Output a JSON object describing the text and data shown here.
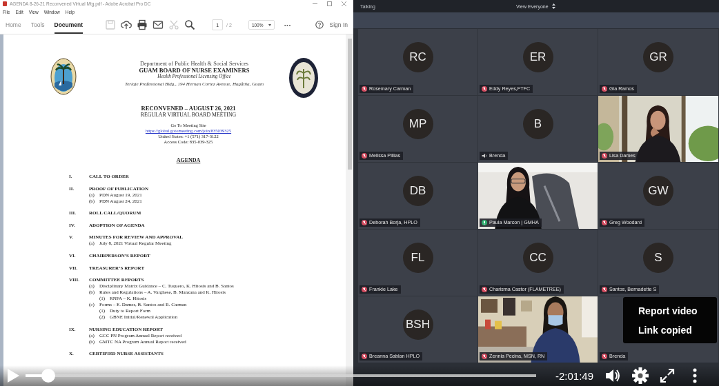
{
  "acrobat": {
    "window_title": "AGENDA 8-26-21 Reconvened Virtual Mtg.pdf - Adobe Acrobat Pro DC",
    "menu": [
      "File",
      "Edit",
      "View",
      "Window",
      "Help"
    ],
    "tabs": [
      {
        "label": "Home",
        "selected": false
      },
      {
        "label": "Tools",
        "selected": false
      },
      {
        "label": "Document",
        "selected": true
      }
    ],
    "tools": [
      {
        "kind": "save",
        "disabled": true
      },
      {
        "kind": "upload",
        "disabled": false
      },
      {
        "kind": "print",
        "disabled": false
      },
      {
        "kind": "mail",
        "disabled": false
      },
      {
        "kind": "scissors",
        "disabled": true
      },
      {
        "kind": "search",
        "disabled": false
      }
    ],
    "page_value": "1",
    "page_total": "/ 2",
    "zoom": "100%",
    "more": "•••",
    "sign_in": "Sign In"
  },
  "document": {
    "department": "Department of Public Health & Social Services",
    "board": "GUAM BOARD OF NURSE EXAMINERS",
    "office": "Health Professional Licensing Office",
    "address": "Terlaje Professional Bldg., 194 Hernan Cortez Avenue, Hagåtña, Guam",
    "meeting_title": "RECONVENED – AUGUST 26, 2021",
    "meeting_subtitle": "REGULAR VIRTUAL BOARD MEETING",
    "site_label": "Go To Meeting Site",
    "site_link": "https://global.gotomeeting.com/join/835039325",
    "phone": "United States: +1 (571) 317-3122",
    "access_code": "Access Code: 835-039-325",
    "agenda_heading": "AGENDA",
    "agenda": [
      {
        "num": "I.",
        "title": "CALL TO ORDER"
      },
      {
        "num": "II.",
        "title": "PROOF OF PUBLICATION",
        "children": [
          {
            "label": "(a)",
            "text": "PDN August 19, 2021"
          },
          {
            "label": "(b)",
            "text": "PDN August 24, 2021"
          }
        ]
      },
      {
        "num": "III.",
        "title": "ROLL CALL/QUORUM"
      },
      {
        "num": "IV.",
        "title": "ADOPTION OF AGENDA"
      },
      {
        "num": "V.",
        "title": "MINUTES FOR REVIEW AND APPROVAL",
        "children": [
          {
            "label": "(a)",
            "text": "July 8, 2021 Virtual Regular Meeting"
          }
        ]
      },
      {
        "num": "VI.",
        "title": "CHAIRPERSON’S REPORT"
      },
      {
        "num": "VII.",
        "title": "TREASURER’S REPORT"
      },
      {
        "num": "VIII.",
        "title": "COMMITTEE REPORTS",
        "children": [
          {
            "label": "(a)",
            "text": "Disciplinary Matrix Guidance – C. Tuquero, K. Hitosis and B. Santos"
          },
          {
            "label": "(b)",
            "text": "Rules and Regulations – A. Varghese, B. Manzana and K. Hitosis",
            "children": [
              {
                "label": "(1)",
                "text": "RNFA – K. Hitosis"
              }
            ]
          },
          {
            "label": "(c)",
            "text": "Forms – E. Dames, B. Santos and R. Carman",
            "children": [
              {
                "label": "(1)",
                "text": "Duty to Report Form"
              },
              {
                "label": "(2)",
                "text": "GBNE Initial/Renewal Application"
              }
            ]
          }
        ]
      },
      {
        "num": "IX.",
        "title": "NURSING EDUCATION REPORT",
        "children": [
          {
            "label": "(a)",
            "text": "GCC PN Program Annual Report received"
          },
          {
            "label": "(b)",
            "text": "GMTC NA Program Annual Report received"
          }
        ]
      },
      {
        "num": "X.",
        "title": "CERTIFIED NURSE ASSISTANTS"
      }
    ]
  },
  "meeting": {
    "status": "Talking",
    "view": "View Everyone",
    "tiles": [
      {
        "kind": "avatar",
        "initials": "RC",
        "name": "Rosemary Carman",
        "muted": true
      },
      {
        "kind": "avatar",
        "initials": "ER",
        "name": "Eddy Reyes,FTFC",
        "muted": true
      },
      {
        "kind": "avatar",
        "initials": "GR",
        "name": "Gia Ramos",
        "muted": true
      },
      {
        "kind": "avatar",
        "initials": "MP",
        "name": "Melissa Pillias",
        "muted": true
      },
      {
        "kind": "avatar",
        "initials": "B",
        "name": "Brenda",
        "audio_only": true
      },
      {
        "kind": "video",
        "name": "Lisa Dames",
        "muted": true
      },
      {
        "kind": "avatar",
        "initials": "DB",
        "name": "Deborah Borja, HPLO",
        "muted": true
      },
      {
        "kind": "video",
        "name": "Paula Marcon | GMHA",
        "muted": false
      },
      {
        "kind": "avatar",
        "initials": "GW",
        "name": "Greg Woodard",
        "muted": true
      },
      {
        "kind": "avatar",
        "initials": "FL",
        "name": "Frankie Lake",
        "muted": true
      },
      {
        "kind": "avatar",
        "initials": "CC",
        "name": "Charisma Castor (FLAMETREE)",
        "muted": true
      },
      {
        "kind": "avatar",
        "initials": "S",
        "name": "Santos, Bernadette S",
        "muted": true
      },
      {
        "kind": "avatar",
        "initials": "BSH",
        "name": "Breanna Sablan HPLO",
        "muted": true
      },
      {
        "kind": "video",
        "name": "Zennia Pecina, MSN, RN",
        "muted": true
      },
      {
        "kind": "covered",
        "name": "Brenda",
        "muted": true
      }
    ]
  },
  "player": {
    "level": 0.045,
    "time": "-2:01:49"
  },
  "menu_popup": [
    "Report video",
    "Link copied"
  ]
}
